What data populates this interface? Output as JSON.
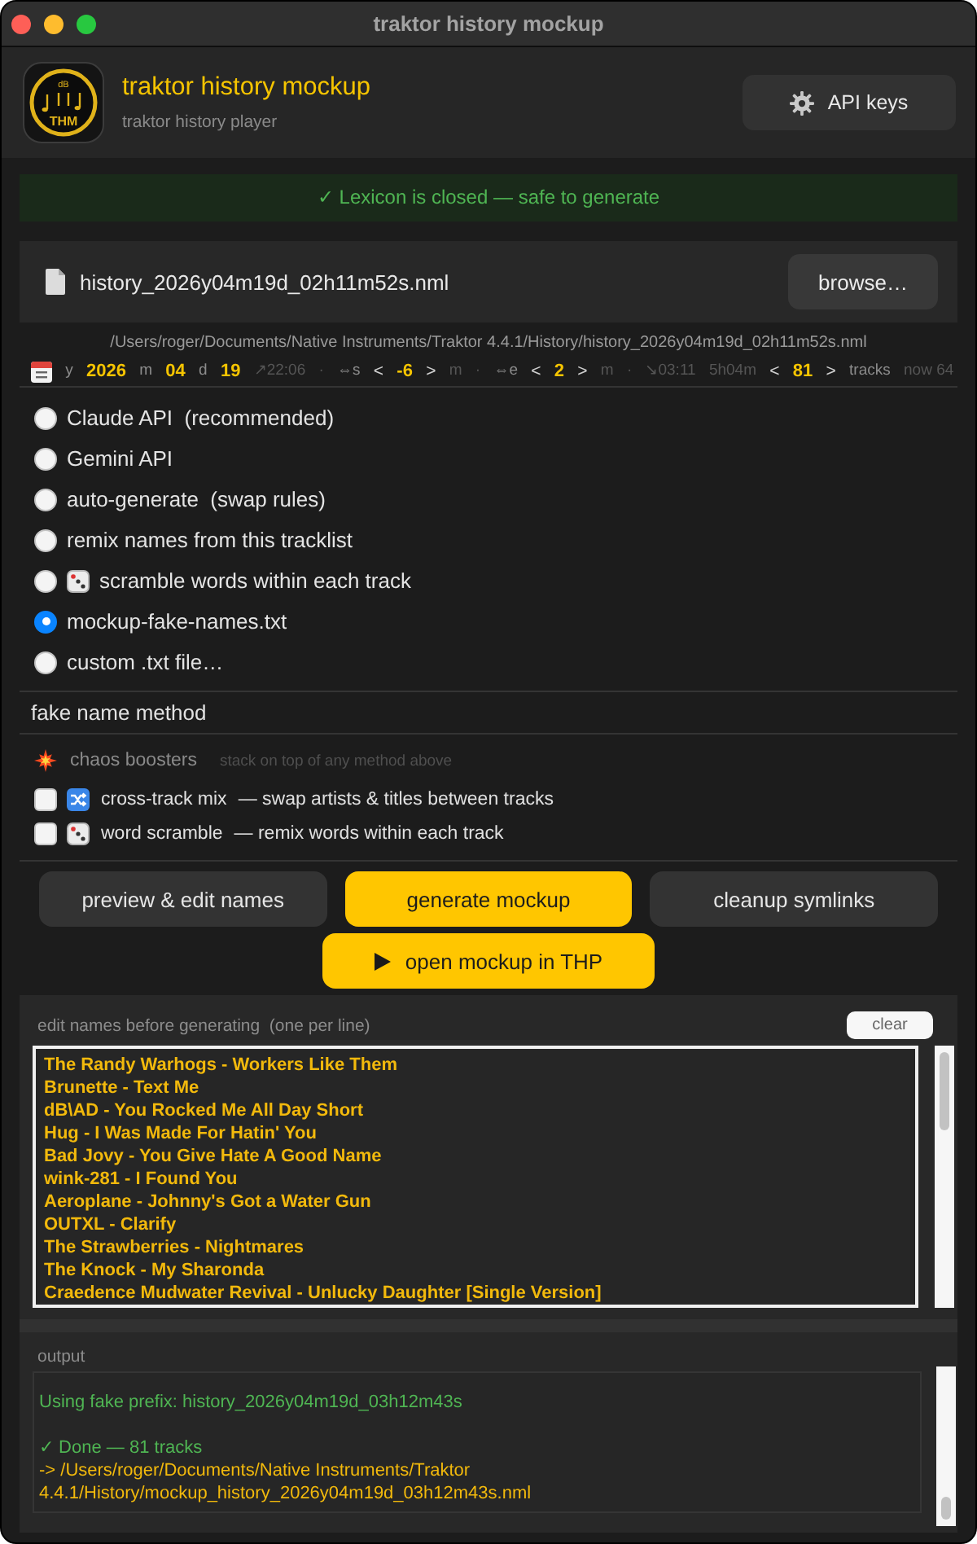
{
  "window": {
    "title": "traktor history mockup"
  },
  "header": {
    "logo": {
      "text": "THM",
      "mark": "dB"
    },
    "title": "traktor history mockup",
    "subtitle": "traktor history player",
    "api_button": "API keys"
  },
  "status_banner": {
    "kind": "ok",
    "text": "✓ Lexicon is closed — safe to generate"
  },
  "file": {
    "name": "history_2026y04m19d_02h11m52s.nml",
    "browse_button": "browse…",
    "path": "/Users/roger/Documents/Native Instruments/Traktor 4.4.1/History/history_2026y04m19d_02h11m52s.nml"
  },
  "date_row": [
    {
      "kind": "label",
      "text": "y"
    },
    {
      "kind": "value",
      "text": "2026"
    },
    {
      "kind": "label",
      "text": "m"
    },
    {
      "kind": "value",
      "text": "04"
    },
    {
      "kind": "label",
      "text": "d"
    },
    {
      "kind": "value",
      "text": "19"
    },
    {
      "kind": "faint",
      "text": "↗22:06"
    },
    {
      "kind": "dot",
      "text": "·"
    },
    {
      "kind": "label",
      "text": "⇔s"
    },
    {
      "kind": "stepper",
      "text": "<"
    },
    {
      "kind": "value",
      "text": "-6"
    },
    {
      "kind": "stepper",
      "text": ">"
    },
    {
      "kind": "faint",
      "text": "m"
    },
    {
      "kind": "dot",
      "text": "·"
    },
    {
      "kind": "label",
      "text": "⇔e"
    },
    {
      "kind": "stepper",
      "text": "<"
    },
    {
      "kind": "value",
      "text": "2"
    },
    {
      "kind": "stepper",
      "text": ">"
    },
    {
      "kind": "faint",
      "text": "m"
    },
    {
      "kind": "dot",
      "text": "·"
    },
    {
      "kind": "faint",
      "text": "↘03:11"
    },
    {
      "kind": "faint",
      "text": "5h04m"
    },
    {
      "kind": "stepper",
      "text": "<"
    },
    {
      "kind": "value",
      "text": "81"
    },
    {
      "kind": "stepper",
      "text": ">"
    },
    {
      "kind": "label",
      "text": "tracks"
    },
    {
      "kind": "faint",
      "text": "now 64"
    }
  ],
  "methods": {
    "options": [
      {
        "kind": "plain",
        "label": "Claude API  (recommended)",
        "selected": false
      },
      {
        "kind": "plain",
        "label": "Gemini API",
        "selected": false
      },
      {
        "kind": "plain",
        "label": "auto-generate  (swap rules)",
        "selected": false
      },
      {
        "kind": "plain",
        "label": "remix names from this tracklist",
        "selected": false
      },
      {
        "kind": "dice",
        "label": "scramble words within each track",
        "selected": false
      },
      {
        "kind": "plain",
        "label": "mockup-fake-names.txt",
        "selected": true
      },
      {
        "kind": "plain",
        "label": "custom .txt file…",
        "selected": false
      }
    ],
    "caption": "fake name method"
  },
  "boosters": {
    "title": "chaos boosters",
    "hint": "stack on top of any method above",
    "options": [
      {
        "kind": "shuffle",
        "name": "cross-track mix",
        "description": "— swap artists & titles between tracks",
        "checked": false
      },
      {
        "kind": "dice",
        "name": "word scramble",
        "description": "— remix words within each track",
        "checked": false
      }
    ]
  },
  "actions": [
    {
      "kind": "secondary",
      "label": "preview & edit names"
    },
    {
      "kind": "primary",
      "label": "generate mockup"
    },
    {
      "kind": "secondary",
      "label": "cleanup symlinks"
    }
  ],
  "open_button": {
    "kind": "primary",
    "label": "open mockup in THP"
  },
  "editor": {
    "label": "edit names before generating  (one per line)",
    "clear_button": "clear",
    "lines": [
      "The Randy Warhogs - Workers Like Them",
      "Brunette - Text Me",
      "dB\\AD - You Rocked Me All Day Short",
      "Hug - I Was Made For Hatin' You",
      "Bad Jovy - You Give Hate A Good Name",
      "wink-281 - I Found You",
      "Aeroplane - Johnny's Got a Water Gun",
      "OUTXL - Clarify",
      "The Strawberries - Nightmares",
      "The Knock - My Sharonda",
      "Craedence Mudwater Revival - Unlucky Daughter [Single Version]"
    ]
  },
  "output": {
    "label": "output",
    "blocks": [
      {
        "lines": [
          {
            "kind": "success",
            "text": "Using fake prefix: history_2026y04m19d_03h12m43s"
          }
        ]
      },
      {
        "lines": [
          {
            "kind": "success",
            "text": "✓ Done — 81 tracks"
          },
          {
            "kind": "path",
            "text": "-> /Users/roger/Documents/Native Instruments/Traktor"
          },
          {
            "kind": "path",
            "text": "4.4.1/History/mockup_history_2026y04m19d_03h12m43s.nml"
          }
        ]
      }
    ]
  }
}
